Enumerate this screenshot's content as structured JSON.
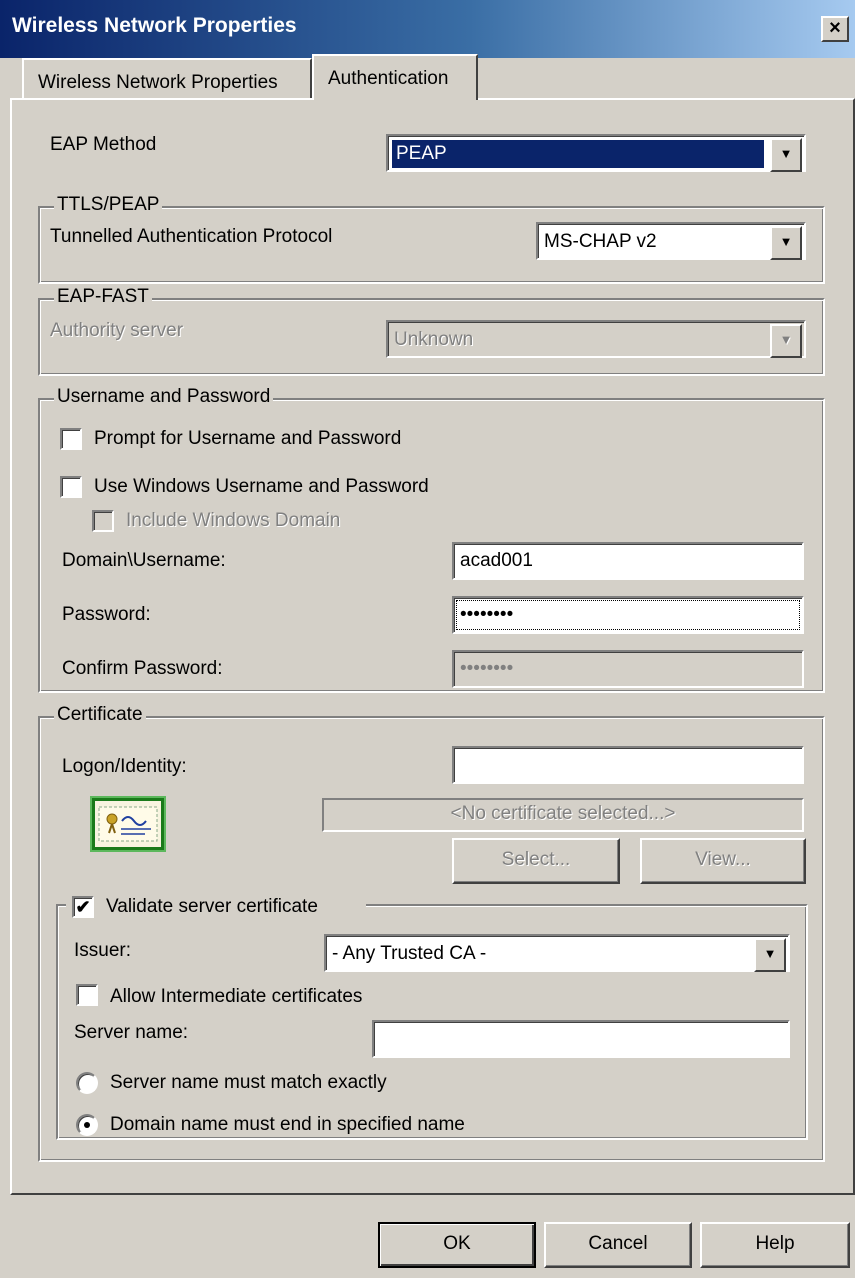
{
  "window": {
    "title": "Wireless Network Properties",
    "close": "×"
  },
  "tabs": [
    {
      "label": "Wireless Network Properties"
    },
    {
      "label": "Authentication"
    }
  ],
  "eap": {
    "label": "EAP Method",
    "value": "PEAP"
  },
  "ttls": {
    "legend": "TTLS/PEAP",
    "label": "Tunnelled Authentication Protocol",
    "value": "MS-CHAP v2"
  },
  "fast": {
    "legend": "EAP-FAST",
    "label": "Authority server",
    "value": "Unknown"
  },
  "userpass": {
    "legend": "Username and Password",
    "prompt": "Prompt for Username and Password",
    "use_windows": "Use Windows Username and Password",
    "include_domain": "Include Windows Domain",
    "username_label": "Domain\\Username:",
    "username_value": "acad001",
    "password_label": "Password:",
    "password_value": "••••••••",
    "confirm_label": "Confirm Password:",
    "confirm_value": "••••••••"
  },
  "certificate": {
    "legend": "Certificate",
    "logon_label": "Logon/Identity:",
    "logon_value": "",
    "no_cert": "<No certificate selected...>",
    "select": "Select...",
    "view": "View..."
  },
  "validate": {
    "label": "Validate server certificate",
    "checked": "✔",
    "issuer_label": "Issuer:",
    "issuer_value": "- Any Trusted CA -",
    "allow_intermediate": "Allow Intermediate certificates",
    "server_name_label": "Server name:",
    "server_name_value": "",
    "match_exactly": "Server name must match exactly",
    "domain_end": "Domain name must end in specified name"
  },
  "buttons": {
    "ok": "OK",
    "cancel": "Cancel",
    "help": "Help"
  },
  "icons": {
    "dropdown": "▼",
    "cert": "certificate-icon"
  },
  "colors": {
    "titlebar": "#0a246a",
    "face": "#d4d0c8",
    "selection": "#0a246a"
  }
}
